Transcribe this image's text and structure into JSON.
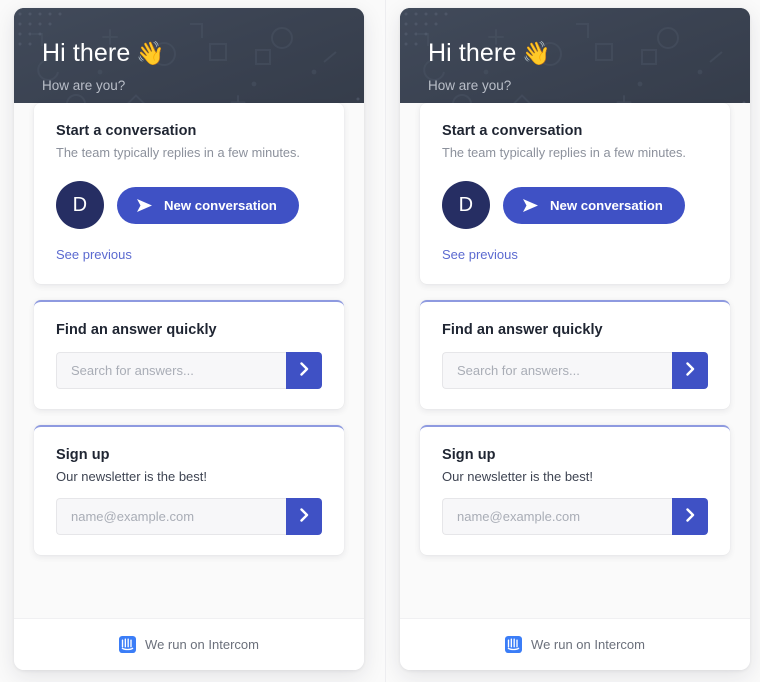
{
  "panels": [
    {
      "header": {
        "greeting": "Hi there",
        "wave_emoji": "👋",
        "subgreeting": "How are you?"
      },
      "conversation_card": {
        "title": "Start a conversation",
        "subtitle": "The team typically replies in a few minutes.",
        "avatar_initial": "D",
        "new_conversation_label": "New conversation",
        "see_previous_label": "See previous"
      },
      "search_card": {
        "title": "Find an answer quickly",
        "input_value": "",
        "input_placeholder": "Search for answers...",
        "submit_icon": "chevron-right-icon"
      },
      "signup_card": {
        "title": "Sign up",
        "subtitle": "Our newsletter is the best!",
        "input_value": "",
        "input_placeholder": "name@example.com",
        "submit_icon": "chevron-right-icon"
      },
      "footer": {
        "text": "We run on Intercom",
        "logo_icon": "intercom-logo-icon"
      }
    },
    {
      "header": {
        "greeting": "Hi there",
        "wave_emoji": "👋",
        "subgreeting": "How are you?"
      },
      "conversation_card": {
        "title": "Start a conversation",
        "subtitle": "The team typically replies in a few minutes.",
        "avatar_initial": "D",
        "new_conversation_label": "New conversation",
        "see_previous_label": "See previous"
      },
      "search_card": {
        "title": "Find an answer quickly",
        "input_value": "",
        "input_placeholder": "Search for answers...",
        "submit_icon": "chevron-right-icon"
      },
      "signup_card": {
        "title": "Sign up",
        "subtitle": "Our newsletter is the best!",
        "input_value": "",
        "input_placeholder": "name@example.com",
        "submit_icon": "chevron-right-icon"
      },
      "footer": {
        "text": "We run on Intercom",
        "logo_icon": "intercom-logo-icon"
      }
    }
  ],
  "theme": {
    "header_background": "#3a4251",
    "accent": "#3f51c5",
    "accent_light": "#8e9ae0",
    "avatar_background": "#262e63",
    "link_color": "#5b6ad0",
    "page_background": "#fafafa",
    "card_background": "#ffffff",
    "muted_text": "#8c919c"
  }
}
